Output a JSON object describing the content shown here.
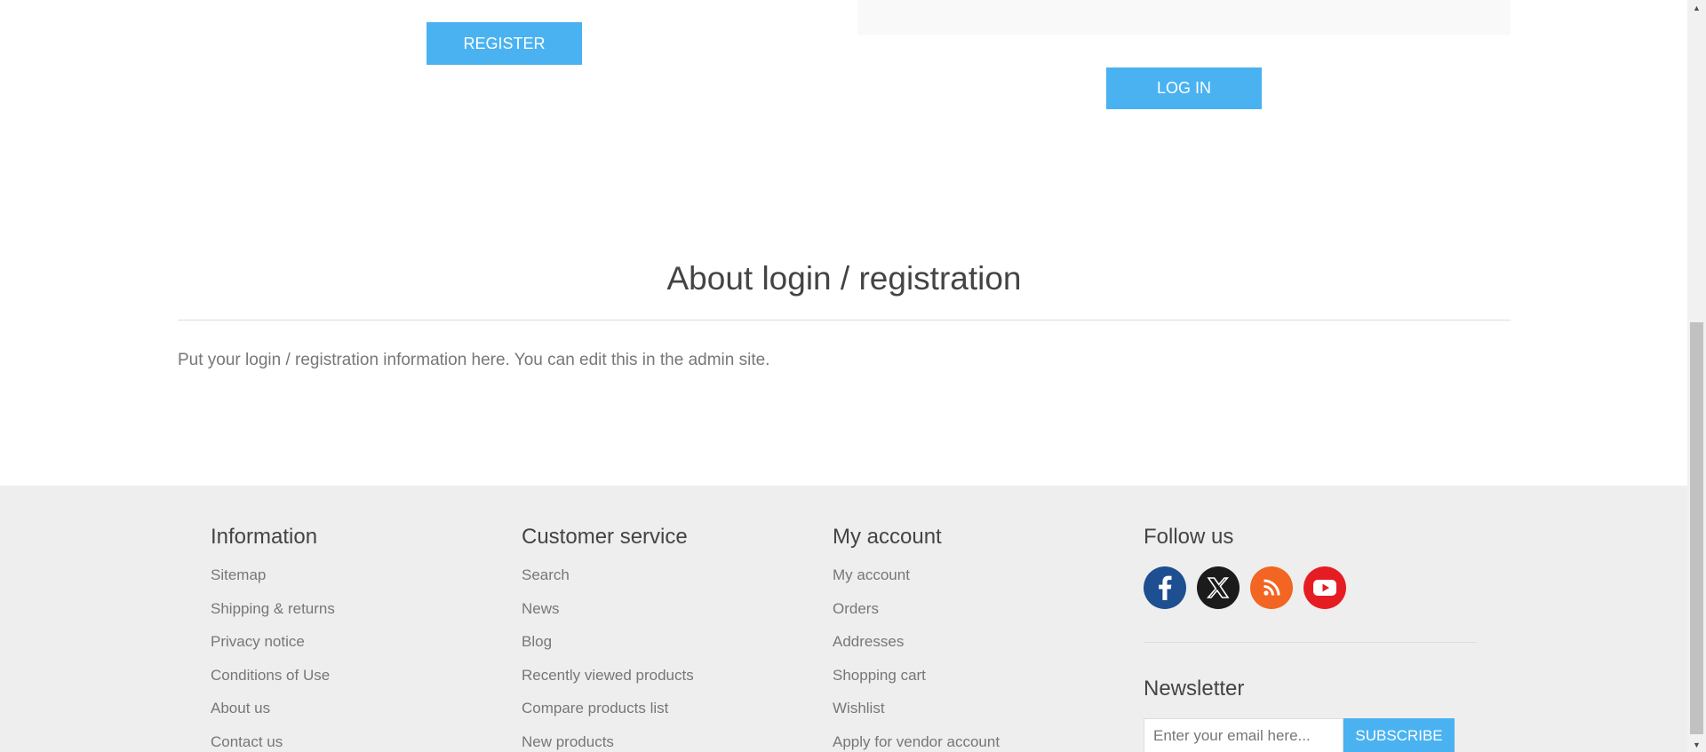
{
  "top": {
    "register_label": "REGISTER",
    "login_label": "LOG IN"
  },
  "about": {
    "title": "About login / registration",
    "text": "Put your login / registration information here. You can edit this in the admin site."
  },
  "footer": {
    "information": {
      "title": "Information",
      "items": [
        "Sitemap",
        "Shipping & returns",
        "Privacy notice",
        "Conditions of Use",
        "About us",
        "Contact us"
      ]
    },
    "customer_service": {
      "title": "Customer service",
      "items": [
        "Search",
        "News",
        "Blog",
        "Recently viewed products",
        "Compare products list",
        "New products"
      ]
    },
    "my_account": {
      "title": "My account",
      "items": [
        "My account",
        "Orders",
        "Addresses",
        "Shopping cart",
        "Wishlist",
        "Apply for vendor account"
      ]
    },
    "follow": {
      "title": "Follow us",
      "icons": [
        "facebook-icon",
        "x-twitter-icon",
        "rss-icon",
        "youtube-icon"
      ]
    },
    "newsletter": {
      "title": "Newsletter",
      "placeholder": "Enter your email here...",
      "subscribe_label": "SUBSCRIBE"
    }
  },
  "colors": {
    "accent": "#4ab2f1",
    "footer_bg": "#eeeeee",
    "facebook": "#1d4f91",
    "x": "#1b1b1b",
    "rss": "#f26522",
    "youtube": "#e61c23"
  }
}
